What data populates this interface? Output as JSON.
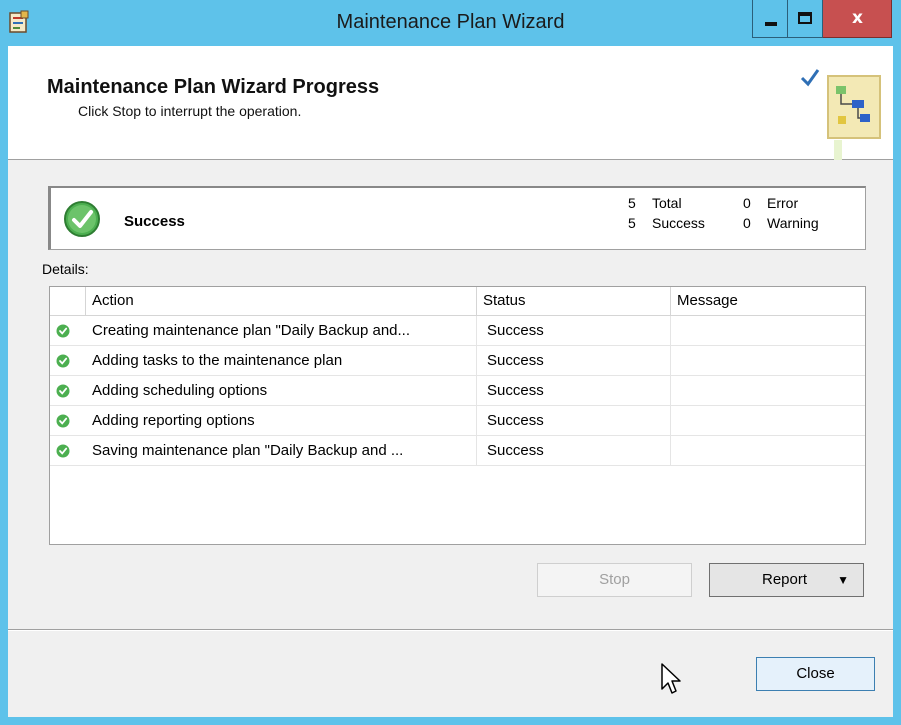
{
  "window": {
    "title": "Maintenance Plan Wizard",
    "close_glyph": "x"
  },
  "header": {
    "title": "Maintenance Plan Wizard Progress",
    "subtitle": "Click Stop to interrupt the operation."
  },
  "summary": {
    "status": "Success",
    "total_count": "5",
    "total_label": "Total",
    "success_count": "5",
    "success_label": "Success",
    "error_count": "0",
    "error_label": "Error",
    "warning_count": "0",
    "warning_label": "Warning"
  },
  "details_label": "Details:",
  "table": {
    "columns": [
      "Action",
      "Status",
      "Message"
    ],
    "rows": [
      {
        "action": "Creating maintenance plan \"Daily Backup and...",
        "status": "Success",
        "message": ""
      },
      {
        "action": "Adding tasks to the maintenance plan",
        "status": "Success",
        "message": ""
      },
      {
        "action": "Adding scheduling options",
        "status": "Success",
        "message": ""
      },
      {
        "action": "Adding reporting options",
        "status": "Success",
        "message": ""
      },
      {
        "action": "Saving maintenance plan \"Daily Backup and ...",
        "status": "Success",
        "message": ""
      }
    ]
  },
  "buttons": {
    "stop": "Stop",
    "report": "Report",
    "close": "Close"
  },
  "icons": {
    "app": "wizard-app-icon",
    "success": "check-circle-icon",
    "header_art": "maintenance-plan-art",
    "report_caret": "caret-down-icon",
    "cursor": "mouse-pointer-icon"
  },
  "colors": {
    "titlebar": "#5ec2ea",
    "success_green": "#4caf50"
  }
}
